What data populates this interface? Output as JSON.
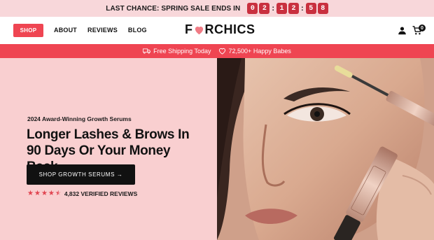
{
  "announcement": {
    "text": "LAST CHANCE: SPRING SALE ENDS IN",
    "countdown": [
      "0",
      "2",
      "1",
      "2",
      "5",
      "8"
    ]
  },
  "header": {
    "shop_label": "SHOP",
    "nav": [
      "ABOUT",
      "REVIEWS",
      "BLOG"
    ],
    "logo_left": "F",
    "logo_right": "RCHICS",
    "cart_count": "0",
    "icons": [
      "account-icon",
      "cart-icon",
      "heart-icon"
    ]
  },
  "promo": {
    "shipping": "Free Shipping Today",
    "babes": "72,500+ Happy Babes",
    "icons": [
      "truck-icon",
      "heart-icon"
    ]
  },
  "hero": {
    "award": "2024 Award-Winning Growth Serums",
    "headline": "Longer Lashes & Brows In 90 Days Or Your Money Back",
    "cta": "SHOP GROWTH SERUMS →",
    "rating": 4.5,
    "reviews": "4,832 VERIFIED REVIEWS",
    "image_name": "model-applying-brow-serum"
  },
  "colors": {
    "announce_bg": "#f8d7da",
    "accent_red": "#ef4552",
    "countdown_bg": "#c9303f",
    "hero_bg": "#f9cfd0"
  }
}
